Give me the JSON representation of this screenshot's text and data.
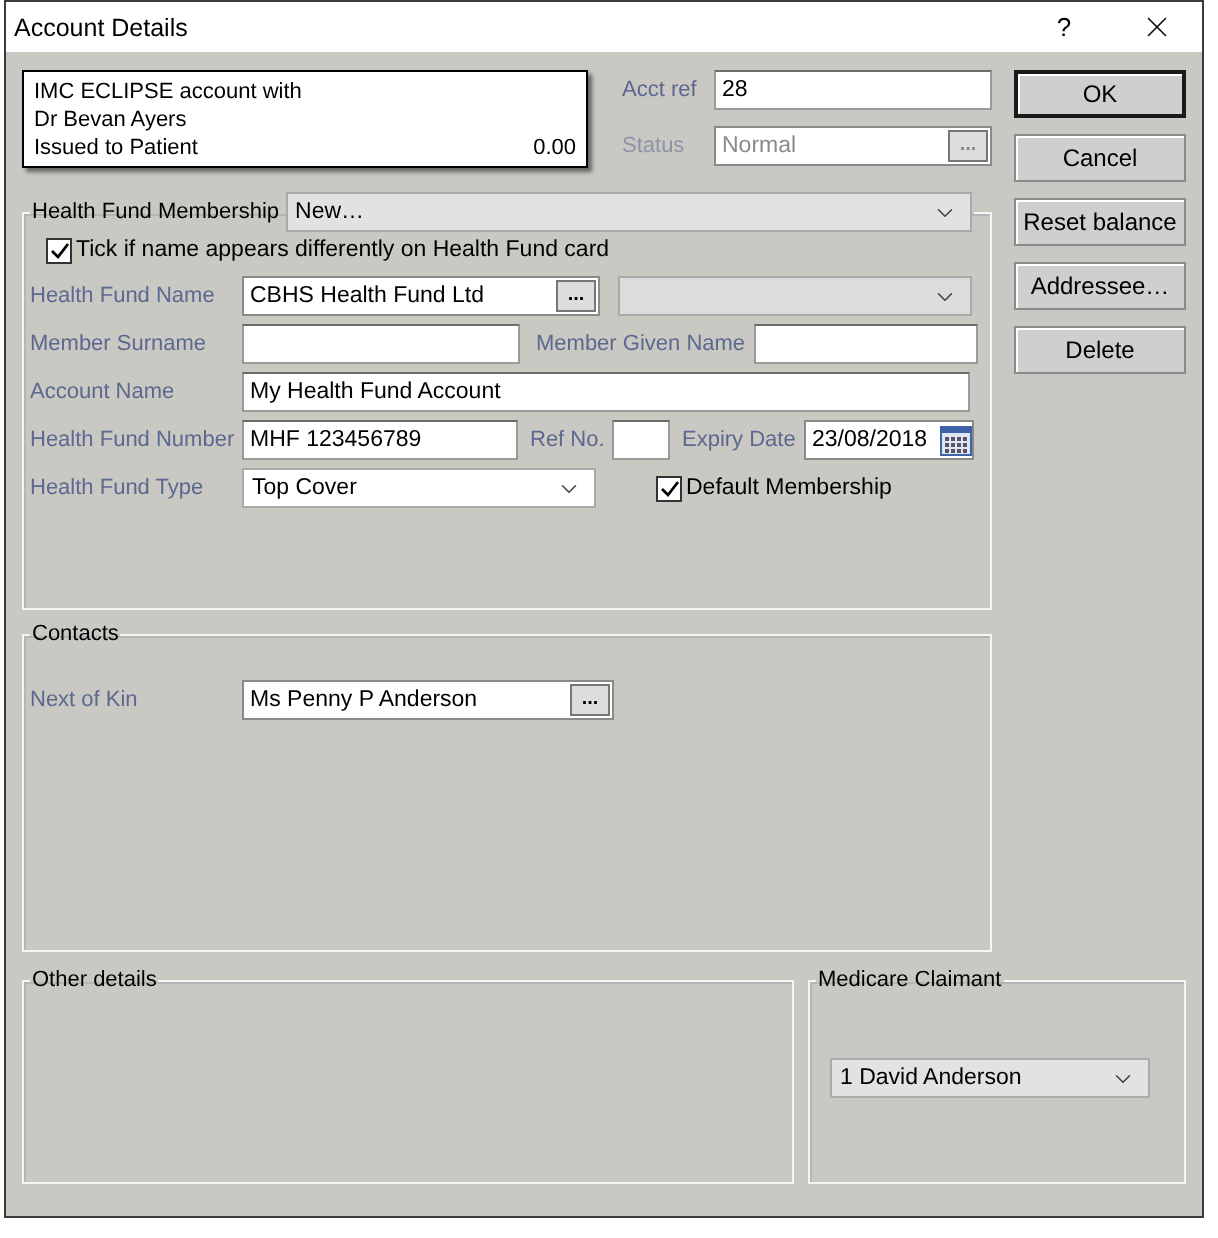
{
  "window": {
    "title": "Account Details",
    "help": "?"
  },
  "summary": {
    "lines": [
      "IMC ECLIPSE account with",
      "Dr Bevan Ayers",
      "Issued to Patient"
    ],
    "balance": "0.00"
  },
  "acct_ref": {
    "label": "Acct ref",
    "value": "28"
  },
  "status": {
    "label": "Status",
    "value": "Normal",
    "disabled": true,
    "browse": "..."
  },
  "health_fund": {
    "legend": "Health Fund Membership",
    "membership": "New…",
    "name_differs": {
      "label": "Tick if name appears differently on Health Fund card",
      "checked": true
    },
    "fund_name": {
      "label": "Health Fund Name",
      "value": "CBHS Health Fund Ltd",
      "browse": "..."
    },
    "member_surname": {
      "label": "Member Surname"
    },
    "member_given_name": {
      "label": "Member Given Name"
    },
    "account_name": {
      "label": "Account Name",
      "value": "My Health Fund Account"
    },
    "fund_number": {
      "label": "Health Fund Number",
      "value": "MHF 123456789"
    },
    "ref_no": {
      "label": "Ref No."
    },
    "expiry_date": {
      "label": "Expiry Date",
      "value": "23/08/2018"
    },
    "fund_type": {
      "label": "Health Fund Type",
      "value": "Top Cover"
    },
    "default_membership": {
      "label": "Default Membership",
      "checked": true
    }
  },
  "contacts": {
    "legend": "Contacts",
    "next_of_kin": {
      "label": "Next of Kin",
      "value": "Ms Penny P Anderson",
      "browse": "..."
    }
  },
  "other_details": {
    "legend": "Other details"
  },
  "medicare_claimant": {
    "legend": "Medicare Claimant",
    "value": "1  David Anderson"
  },
  "buttons": [
    {
      "label": "OK",
      "default": true
    },
    {
      "label": "Cancel",
      "default": false
    },
    {
      "label": "Reset balance",
      "default": false
    },
    {
      "label": "Addressee…",
      "default": false
    },
    {
      "label": "Delete",
      "default": false
    }
  ]
}
